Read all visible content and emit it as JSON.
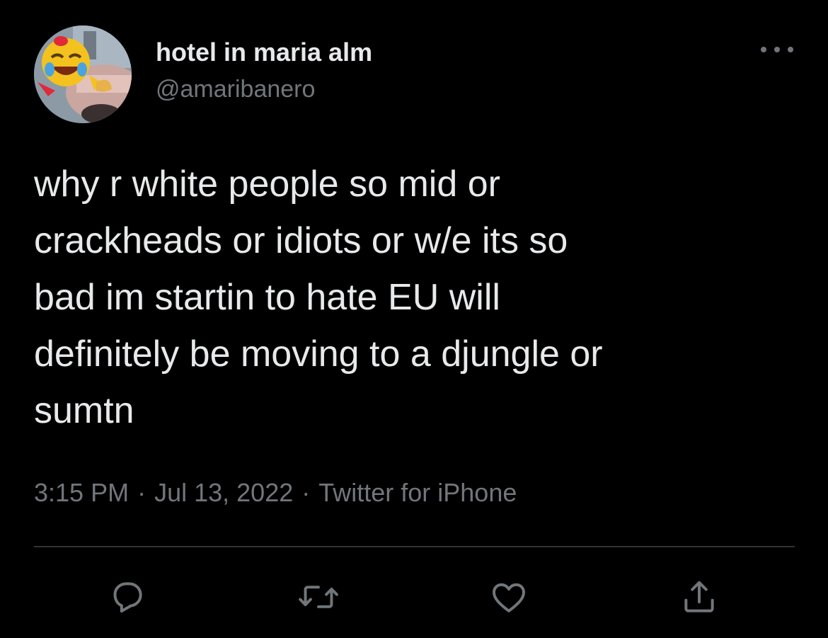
{
  "tweet": {
    "display_name": "hotel in maria alm",
    "handle": "@amaribanero",
    "text": "why r white people so mid or\ncrackheads or idiots or w/e its so\nbad im startin to hate EU will\ndefinitely be moving to a djungle or\nsumtn",
    "time": "3:15 PM",
    "separator": "·",
    "date": "Jul 13, 2022",
    "source": "Twitter for iPhone"
  },
  "icons": {
    "more": "more-horizontal-icon",
    "reply": "reply-icon",
    "retweet": "retweet-icon",
    "like": "heart-icon",
    "share": "share-icon"
  },
  "colors": {
    "background": "#000000",
    "primary_text": "#e7e9ea",
    "secondary_text": "#71767b",
    "divider": "#2f3336"
  }
}
